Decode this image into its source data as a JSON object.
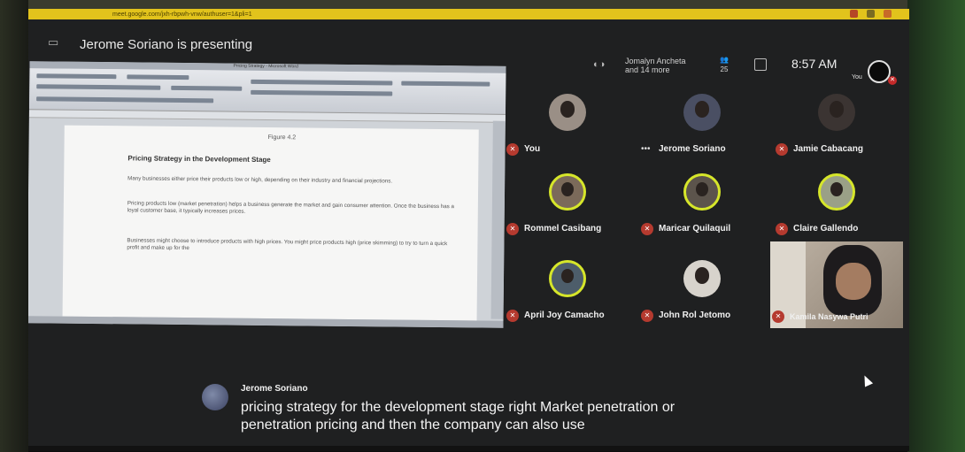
{
  "browser": {
    "url_text": "meet.google.com/jxh-rbpwh-vnw/authuser=1&pli=1"
  },
  "header": {
    "presenting_text": "Jerome Soriano is presenting",
    "people_text_1": "Jomalyn Ancheta",
    "people_text_2": "and 14 more",
    "participant_count": "25",
    "clock": "8:57 AM",
    "you_label": "You"
  },
  "document": {
    "window_title": "Pricing Strategy - Microsoft Word",
    "figure_label": "Figure 4.2",
    "heading": "Pricing Strategy in the Development Stage",
    "paragraphs": [
      "Many businesses either price their products low or high, depending on their industry and financial projections.",
      "Pricing products low (market penetration) helps a business generate the market and gain consumer attention. Once the business has a loyal customer base, it typically increases prices.",
      "Businesses might choose to introduce products with high prices. You might price products high (price skimming) to try to turn a quick profit and make up for the"
    ]
  },
  "participants": [
    {
      "name": "You",
      "muted": true
    },
    {
      "name": "Jerome Soriano",
      "muted": false
    },
    {
      "name": "Jamie Cabacang",
      "muted": true
    },
    {
      "name": "Rommel Casibang",
      "muted": true
    },
    {
      "name": "Maricar Quilaquil",
      "muted": true
    },
    {
      "name": "Claire Gallendo",
      "muted": true
    },
    {
      "name": "April Joy Camacho",
      "muted": true
    },
    {
      "name": "John Rol Jetomo",
      "muted": true
    },
    {
      "name": "Kamila Nasywa Putri",
      "muted": true
    }
  ],
  "captions": {
    "speaker": "Jerome Soriano",
    "line1": "pricing strategy for the development stage right Market penetration or",
    "line2": "penetration pricing and then the company can also use"
  },
  "icons": {
    "mic_off": "mic-off-icon",
    "more": "more-options-icon",
    "present": "present-screen-icon",
    "chat": "chat-icon"
  }
}
